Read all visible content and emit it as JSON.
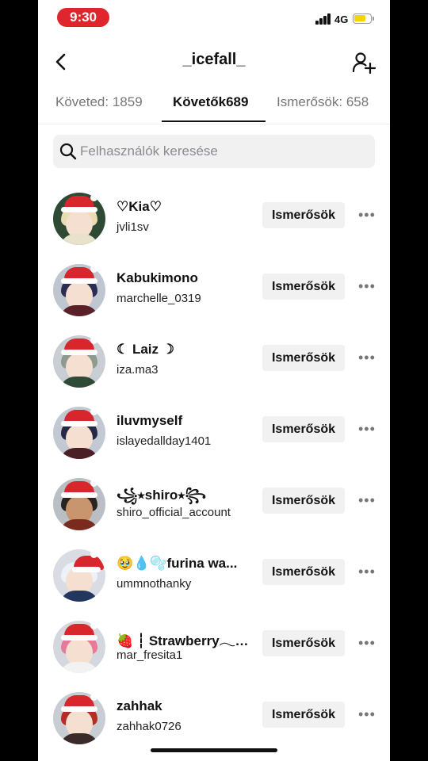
{
  "status_bar": {
    "time": "9:30",
    "network": "4G"
  },
  "header": {
    "title": "_icefall_"
  },
  "tabs": [
    {
      "label": "Követed: 1859"
    },
    {
      "label": "Követők689"
    },
    {
      "label": "Ismerősök: 658"
    }
  ],
  "search": {
    "placeholder": "Felhasználók keresése"
  },
  "users": [
    {
      "name": "♡Kia♡",
      "handle": "jvli1sv",
      "button": "Ismerősök"
    },
    {
      "name": "Kabukimono",
      "handle": "marchelle_0319",
      "button": "Ismerősök"
    },
    {
      "name": "☾ Laiz ☽",
      "handle": "iza.ma3",
      "button": "Ismerősök"
    },
    {
      "name": "iluvmyself",
      "handle": "islayedallday1401",
      "button": "Ismerősök"
    },
    {
      "name": "꧁⭑shiro⭑꧂",
      "handle": "shiro_official_account",
      "button": "Ismerősök"
    },
    {
      "name": "🥹💧🫧furina wa...",
      "handle": "ummnothanky",
      "button": "Ismerősök"
    },
    {
      "name": "🍓 ┆ Strawberry𓂃 ⋌",
      "handle": "mar_fresita1",
      "button": "Ismerősök"
    },
    {
      "name": "zahhak",
      "handle": "zahhak0726",
      "button": "Ismerősök"
    }
  ],
  "icons": {
    "back": "chevron-left-icon",
    "add_user": "add-user-icon",
    "search": "search-icon",
    "more": "more-horizontal-icon"
  },
  "colors": {
    "time_pill": "#e0262d",
    "battery": "#f5d20a",
    "button_bg": "#f1f1f2"
  }
}
